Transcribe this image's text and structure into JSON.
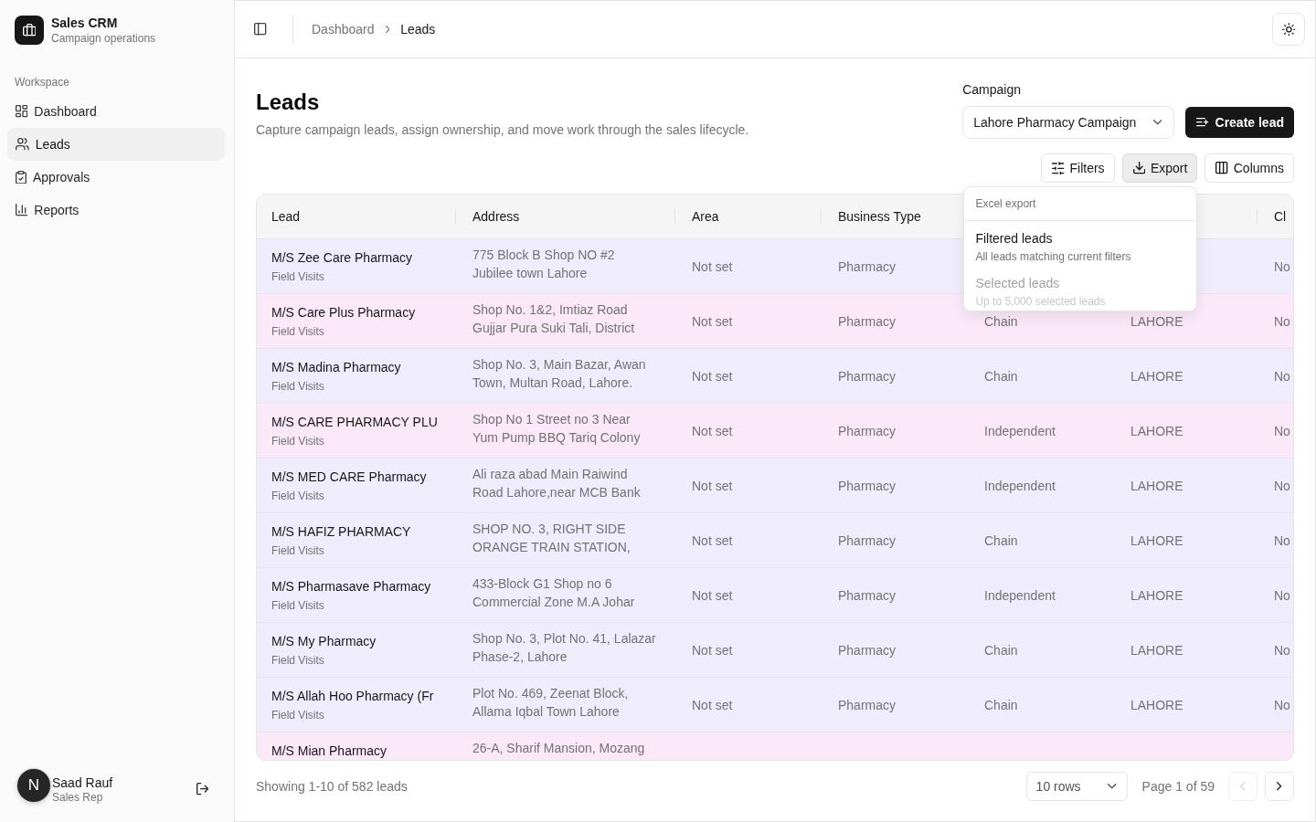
{
  "sidebar": {
    "brand": {
      "title": "Sales CRM",
      "subtitle": "Campaign operations"
    },
    "section": "Workspace",
    "items": [
      {
        "label": "Dashboard",
        "selected": false
      },
      {
        "label": "Leads",
        "selected": true
      },
      {
        "label": "Approvals",
        "selected": false
      },
      {
        "label": "Reports",
        "selected": false
      }
    ],
    "user": {
      "initial": "N",
      "name": "Saad Rauf",
      "role": "Sales Rep"
    }
  },
  "header": {
    "breadcrumb": [
      "Dashboard",
      "Leads"
    ]
  },
  "page": {
    "title": "Leads",
    "subtitle": "Capture campaign leads, assign ownership, and move work through the sales lifecycle.",
    "campaign": {
      "label": "Campaign",
      "value": "Lahore Pharmacy Campaign"
    },
    "create_button": "Create lead"
  },
  "toolbar": [
    {
      "label": "Filters",
      "expanded": false
    },
    {
      "label": "Export",
      "expanded": true
    },
    {
      "label": "Columns",
      "expanded": false
    }
  ],
  "export_menu": {
    "title": "Excel export",
    "items": [
      {
        "label": "Filtered leads",
        "description": "All leads matching current filters",
        "disabled": false
      },
      {
        "label": "Selected leads",
        "description": "Up to 5,000 selected leads",
        "disabled": true
      }
    ]
  },
  "table": {
    "columns": {
      "lead": "Lead",
      "address": "Address",
      "area": "Area",
      "business_type": "Business Type",
      "column_7": "Cl"
    },
    "rows": [
      {
        "lead": "M/S Zee Care Pharmacy",
        "subtitle": "Field Visits",
        "address": [
          "775 Block B Shop NO #2",
          "Jubilee town Lahore"
        ],
        "area": "Not set",
        "business_type": "Pharmacy",
        "column_7": "No",
        "color": "#efecfc"
      },
      {
        "lead": "M/S Care Plus Pharmacy",
        "subtitle": "Field Visits",
        "address": [
          "Shop No. 1&2, Imtiaz Road",
          "Gujjar Pura Suki Tali, District"
        ],
        "area": "Not set",
        "business_type": "Pharmacy",
        "column_5": "Chain",
        "column_6": "LAHORE",
        "column_7": "No",
        "color": "#fbe9fa"
      },
      {
        "lead": "M/S Madina Pharmacy",
        "subtitle": "Field Visits",
        "address": [
          "Shop No. 3, Main Bazar, Awan",
          "Town, Multan Road, Lahore."
        ],
        "area": "Not set",
        "business_type": "Pharmacy",
        "column_5": "Chain",
        "column_6": "LAHORE",
        "column_7": "No",
        "color": "#efecfc"
      },
      {
        "lead": "M/S CARE PHARMACY PLU",
        "subtitle": "Field Visits",
        "address": [
          "Shop No 1 Street no 3 Near",
          "Yum Pump BBQ Tariq Colony"
        ],
        "area": "Not set",
        "business_type": "Pharmacy",
        "column_5": "Independent",
        "column_6": "LAHORE",
        "column_7": "No",
        "color": "#fbe9fa"
      },
      {
        "lead": "M/S MED CARE Pharmacy",
        "subtitle": "Field Visits",
        "address": [
          "Ali raza abad Main Raiwind",
          "Road Lahore,near MCB Bank"
        ],
        "area": "Not set",
        "business_type": "Pharmacy",
        "column_5": "Independent",
        "column_6": "LAHORE",
        "column_7": "No",
        "color": "#efecfc"
      },
      {
        "lead": "M/S HAFIZ PHARMACY",
        "subtitle": "Field Visits",
        "address": [
          "SHOP NO. 3, RIGHT SIDE",
          "ORANGE TRAIN STATION,"
        ],
        "area": "Not set",
        "business_type": "Pharmacy",
        "column_5": "Chain",
        "column_6": "LAHORE",
        "column_7": "No",
        "color": "#efecfc"
      },
      {
        "lead": "M/S Pharmasave Pharmacy",
        "subtitle": "Field Visits",
        "address": [
          "433-Block G1 Shop no 6",
          "Commercial Zone M.A Johar"
        ],
        "area": "Not set",
        "business_type": "Pharmacy",
        "column_5": "Independent",
        "column_6": "LAHORE",
        "column_7": "No",
        "color": "#efecfc"
      },
      {
        "lead": "M/S My Pharmacy",
        "subtitle": "Field Visits",
        "address": [
          "Shop No. 3, Plot No. 41, Lalazar",
          "Phase-2, Lahore"
        ],
        "area": "Not set",
        "business_type": "Pharmacy",
        "column_5": "Chain",
        "column_6": "LAHORE",
        "column_7": "No",
        "color": "#efecfc"
      },
      {
        "lead": "M/S Allah Hoo Pharmacy (Fr",
        "subtitle": "Field Visits",
        "address": [
          "Plot No. 469, Zeenat Block,",
          "Allama Iqbal Town Lahore"
        ],
        "area": "Not set",
        "business_type": "Pharmacy",
        "column_5": "Chain",
        "column_6": "LAHORE",
        "column_7": "No",
        "color": "#efecfc"
      },
      {
        "lead": "M/S Mian Pharmacy",
        "address": [
          "26-A, Sharif Mansion, Mozang"
        ],
        "color": "#fbe9fa"
      }
    ]
  },
  "footer": {
    "summary": "Showing 1-10 of 582 leads",
    "rows_per_page": "10 rows",
    "page": "Page 1 of 59",
    "previous": {
      "disabled": true
    },
    "next": {
      "disabled": false
    }
  }
}
